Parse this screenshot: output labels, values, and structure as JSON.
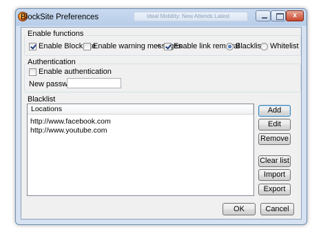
{
  "window": {
    "title": "BlockSite Preferences",
    "background_tab_text": "Ideal Mobility: New Attends Latest",
    "controls": {
      "minimize": "–",
      "maximize": "□",
      "close": "x"
    }
  },
  "enable_functions": {
    "group_label": "Enable functions",
    "enable_blocksite": {
      "label": "Enable BlockSite",
      "checked": true
    },
    "enable_warning": {
      "label": "Enable warning messages",
      "checked": false
    },
    "plus_sign": "+",
    "enable_link_removal": {
      "label": "Enable link removal",
      "checked": true
    },
    "mode_blacklist": {
      "label": "Blacklist",
      "selected": true
    },
    "mode_whitelist": {
      "label": "Whitelist",
      "selected": false
    }
  },
  "authentication": {
    "group_label": "Authentication",
    "enable_authentication": {
      "label": "Enable authentication",
      "checked": false
    },
    "new_password_label": "New password",
    "new_password_value": ""
  },
  "blacklist": {
    "group_label": "Blacklist",
    "column_header": "Locations",
    "rows": [
      "http://www.facebook.com",
      "http://www.youtube.com"
    ],
    "buttons": {
      "add": "Add",
      "edit": "Edit",
      "remove": "Remove",
      "clear_list": "Clear list",
      "import": "Import",
      "export": "Export"
    }
  },
  "dialog_buttons": {
    "ok": "OK",
    "cancel": "Cancel"
  },
  "colors": {
    "title_bar": "#c9daf0",
    "client_bg": "#f0f0f0",
    "default_button_border": "#3c7fb1",
    "checkmark": "#1d3c7a"
  }
}
